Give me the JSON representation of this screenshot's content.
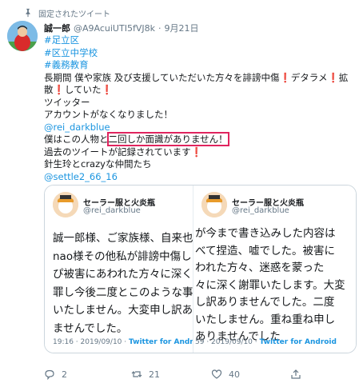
{
  "pinned": {
    "label": "固定されたツイート",
    "icon": "pin-icon"
  },
  "tweet": {
    "name": "誠一郎",
    "handle": "@A9AcuiUTI5fVJ8k",
    "dot": "·",
    "date": "9月21日",
    "hashtag1": "#足立区",
    "hashtag2": "#区立中学校",
    "hashtag3": "#義務教育",
    "l4": "長期間 僕や家族 及び支援していただいた方々を誹謗中傷",
    "l4b": "デタラメ",
    "l4c": "拡",
    "l5a": "散",
    "l5b": "していた",
    "l6": "ツイッター",
    "l7": "アカウントがなくなりました！",
    "mention1": "@rei_darkblue",
    "l9a": "僕はこの人物と",
    "l9b": "二回しか面識がありません！",
    "l10": "過去のツイートが記録されています",
    "l11": "針生玲とcrazyな仲間たち",
    "mention2": "@settle2_66_16"
  },
  "embed_left": {
    "name": "セーラー服と火炎瓶",
    "handle": "@rei_darkblue",
    "lines": [
      "誠一郎様、ご家族様、自来也",
      "nao様その他私が誹謗中傷し",
      "ぴ被害にあわれた方々に深く",
      "罪し今後二度とこのような事",
      "いたしません。大変申し訳あ",
      "ませんでした。"
    ],
    "time": "19:16 · 2019/09/10 · ",
    "source": "Twitter for Android"
  },
  "embed_right": {
    "name": "セーラー服と火炎瓶",
    "handle": "@rei_darkblue",
    "lines": [
      "が今まで書き込みした内容は",
      "べて捏造、嘘でした。被害に",
      "われた方々、迷惑を蒙った",
      "々に深く謝罪いたします。大変",
      "し訳ありませんでした。二度",
      "いたしません。重ね重ね申し",
      "ありませんでした"
    ],
    "time": "59 · 2019/09/10 · ",
    "source": "Twitter for Android"
  },
  "actions": {
    "replies": "2",
    "retweets": "21",
    "likes": "40"
  },
  "colors": {
    "link": "#1b95e0",
    "highlight": "#e0245e",
    "secondary": "#657786"
  }
}
